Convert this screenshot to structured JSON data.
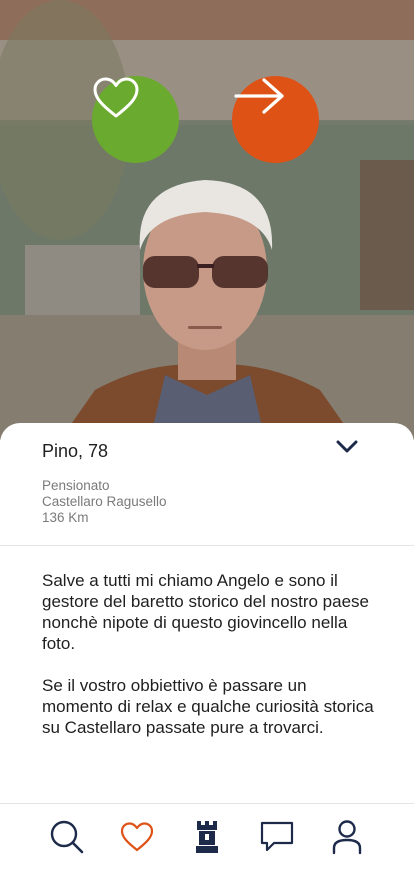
{
  "actions": {
    "like_icon": "heart-outline-icon",
    "next_icon": "arrow-right-icon",
    "like_color": "#6aaa2e",
    "next_color": "#df5216"
  },
  "profile": {
    "name_age": "Pino, 78",
    "occupation": "Pensionato",
    "location": "Castellaro Ragusello",
    "distance": "136 Km",
    "bio_paragraphs": [
      "Salve a tutti mi chiamo Angelo e sono il gestore del baretto storico del nostro paese nonchè nipote di questo giovincello nella foto.",
      "Se il vostro obbiettivo è passare un momento di relax e qualche curiosità storica su Castellaro passate pure a trovarci."
    ]
  },
  "nav": {
    "items": [
      "search-icon",
      "heart-icon",
      "tower-icon",
      "chat-icon",
      "profile-icon"
    ],
    "active": "heart-icon",
    "active_color": "#df5216",
    "default_color": "#1e2a4a"
  }
}
